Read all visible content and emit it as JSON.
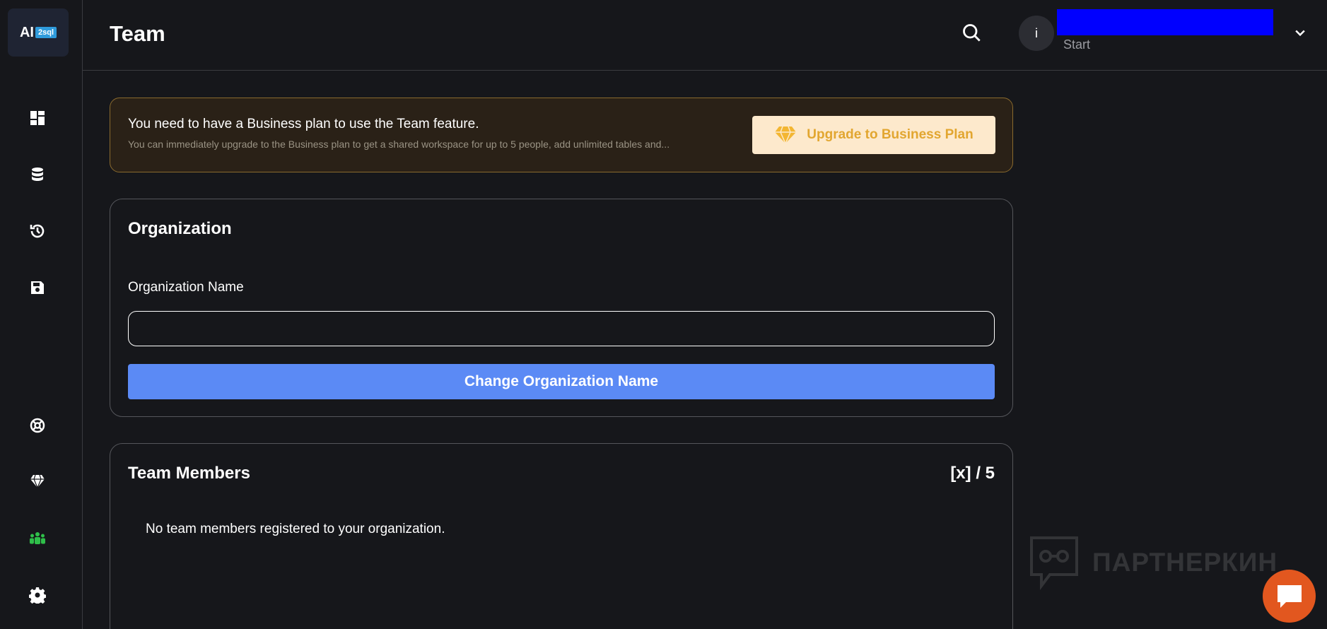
{
  "logo": {
    "main": "AI",
    "badge": "2sql"
  },
  "header": {
    "title": "Team",
    "avatar_initial": "i",
    "user_plan": "Start"
  },
  "sidebar": {
    "items": [
      {
        "icon": "dashboard-icon"
      },
      {
        "icon": "database-icon"
      },
      {
        "icon": "history-icon"
      },
      {
        "icon": "save-icon"
      },
      {
        "icon": "support-icon"
      },
      {
        "icon": "diamond-icon"
      },
      {
        "icon": "team-icon",
        "active": true
      },
      {
        "icon": "gear-icon"
      }
    ],
    "active_color": "#2fbf4a"
  },
  "banner": {
    "title": "You need to have a Business plan to use the Team feature.",
    "description": "You can immediately upgrade to the Business plan to get a shared workspace for up to 5 people, add unlimited tables and...",
    "upgrade_label": "Upgrade to Business Plan"
  },
  "organization": {
    "title": "Organization",
    "field_label": "Organization Name",
    "field_value": "",
    "button_label": "Change Organization Name"
  },
  "team_members": {
    "title": "Team Members",
    "count": "[x] / 5",
    "empty_message": "No team members registered to your organization."
  },
  "watermark": {
    "text": "ПАРТНЕРКИН"
  },
  "colors": {
    "background": "#16171b",
    "accent_blue": "#5b8af5",
    "upgrade_gold": "#e2a630",
    "chat_orange": "#e2571f"
  }
}
